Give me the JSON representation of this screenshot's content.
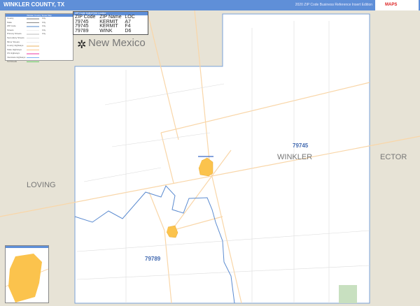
{
  "header": {
    "title": "WINKLER COUNTY, TX",
    "edition": "2020 ZIP Code Business Reference Insert Edition",
    "logo": "MAPS"
  },
  "map": {
    "state_label": "New Mexico",
    "county_labels": [
      "WINKLER",
      "LOVING",
      "ECTOR"
    ],
    "zip_labels": [
      "79745",
      "79789"
    ]
  },
  "zip_index": {
    "title": "ZIP Code Index/Grid Locator",
    "columns": [
      "ZIP Code",
      "ZIP Name",
      "LOC"
    ],
    "rows": [
      [
        "79745",
        "KERMIT",
        "A7"
      ],
      [
        "79745",
        "KERMIT",
        "F4"
      ],
      [
        "79789",
        "WINK",
        "D6"
      ]
    ]
  },
  "legend": {
    "title": "Winkler County Texas Map",
    "items": [
      "County",
      "State",
      "ZIP Code",
      "Streets",
      "Primary Streets",
      "Secondary Streets",
      "Minor Streets",
      "County Highways",
      "State Highways",
      "US Highways",
      "Interstate Highways",
      "Toll Roads"
    ],
    "colors": [
      "#bbbbbb",
      "#888888",
      "#a8c4e6",
      "#eeeeee",
      "#dddddd",
      "#dddddd",
      "#eeeeee",
      "#f5d9b0",
      "#fbc98a",
      "#f59ad0",
      "#7fb0f0",
      "#66cc66"
    ],
    "city_sizes": [
      "City",
      "City",
      "City",
      "City",
      "City"
    ]
  },
  "colors": {
    "header": "#5f8fd8",
    "land": "#e7e3d6",
    "city": "#fbc34d",
    "water": "#5b8bd0",
    "road": "#f9d6a8"
  }
}
